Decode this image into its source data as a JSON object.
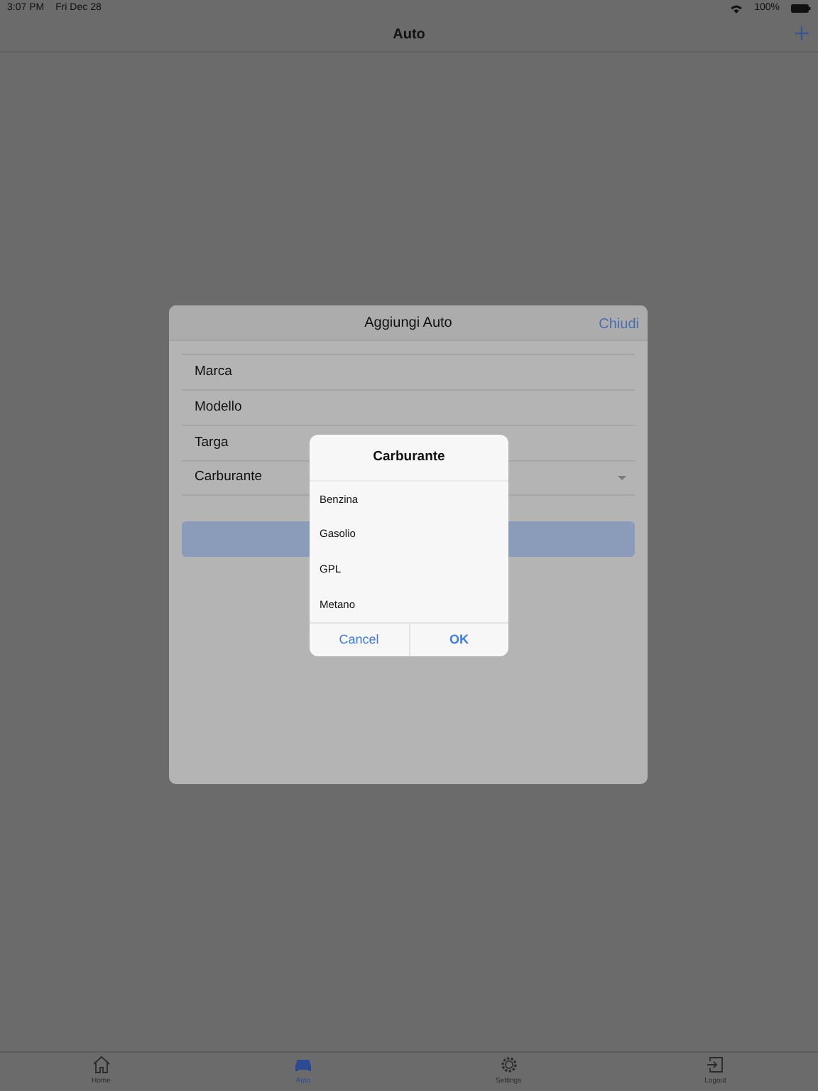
{
  "status_bar": {
    "time": "3:07 PM",
    "date": "Fri Dec 28",
    "battery": "100%"
  },
  "nav_bar": {
    "title": "Auto"
  },
  "dialog": {
    "title": "Aggiungi Auto",
    "close": "Chiudi",
    "fields": [
      {
        "label": "Marca",
        "kind": "text"
      },
      {
        "label": "Modello",
        "kind": "text"
      },
      {
        "label": "Targa",
        "kind": "text"
      },
      {
        "label": "Carburante",
        "kind": "select"
      }
    ]
  },
  "picker": {
    "title": "Carburante",
    "options": [
      {
        "label": "Benzina",
        "selected": false
      },
      {
        "label": "Gasolio",
        "selected": false
      },
      {
        "label": "GPL",
        "selected": false
      },
      {
        "label": "Metano",
        "selected": false
      }
    ],
    "buttons": [
      {
        "label": "Cancel",
        "kind": "cancel"
      },
      {
        "label": "OK",
        "kind": "confirm"
      }
    ]
  },
  "tabs": [
    {
      "label": "Home",
      "kind": "home",
      "selected": false
    },
    {
      "label": "Auto",
      "kind": "car",
      "selected": true
    },
    {
      "label": "Settings",
      "kind": "gear",
      "selected": false
    },
    {
      "label": "Logout",
      "kind": "logout",
      "selected": false
    }
  ]
}
